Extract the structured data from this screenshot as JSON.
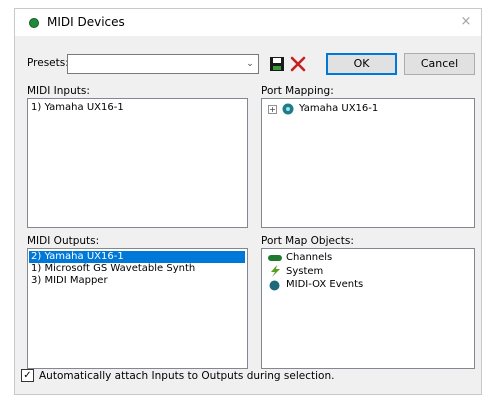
{
  "window": {
    "title": "MIDI Devices",
    "close_symbol": "×"
  },
  "presets": {
    "label": "Presets:",
    "value": "",
    "dropdown_symbol": "⌄"
  },
  "buttons": {
    "ok": "OK",
    "cancel": "Cancel"
  },
  "midi_inputs": {
    "label": "MIDI Inputs:",
    "items": [
      "1) Yamaha UX16-1"
    ]
  },
  "port_mapping": {
    "label": "Port Mapping:",
    "expander": "+",
    "items": [
      "Yamaha UX16-1"
    ]
  },
  "midi_outputs": {
    "label": "MIDI Outputs:",
    "items": [
      "2) Yamaha UX16-1",
      "1) Microsoft GS Wavetable Synth",
      "3) MIDI Mapper"
    ],
    "selected_index": 0
  },
  "port_map_objects": {
    "label": "Port Map Objects:",
    "items": [
      {
        "icon": "channels-icon",
        "label": "Channels"
      },
      {
        "icon": "system-icon",
        "label": "System"
      },
      {
        "icon": "midi-ox-events-icon",
        "label": "MIDI-OX Events"
      }
    ]
  },
  "auto_attach": {
    "label": "Automatically attach Inputs to Outputs during selection.",
    "checked": true,
    "check_symbol": "✓"
  },
  "colors": {
    "selection": "#0078d7",
    "title_icon": "#1f8a3a"
  }
}
